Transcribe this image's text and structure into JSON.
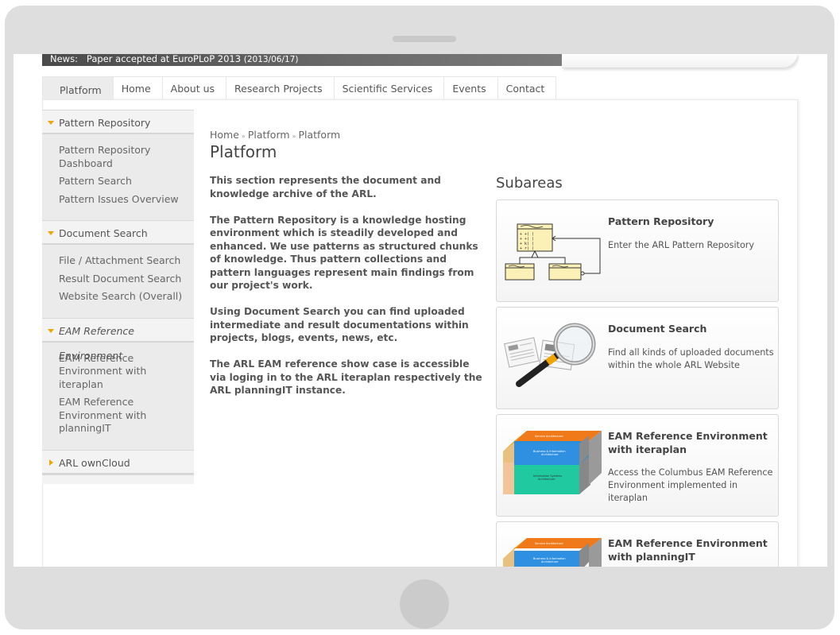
{
  "news": {
    "label": "News:",
    "text": "Paper accepted at EuroPLoP 2013",
    "date": "(2013/06/17)"
  },
  "tabs": [
    {
      "label": "Platform",
      "active": true
    },
    {
      "label": "Home"
    },
    {
      "label": "About us"
    },
    {
      "label": "Research Projects"
    },
    {
      "label": "Scientific Services"
    },
    {
      "label": "Events"
    },
    {
      "label": "Contact"
    }
  ],
  "sidebar": {
    "sections": [
      {
        "title": "Pattern Repository",
        "items": [
          "Pattern Repository Dashboard",
          "Pattern Search",
          "Pattern Issues Overview"
        ]
      },
      {
        "title": "Document Search",
        "items": [
          "File / Attachment Search",
          "Result Document Search",
          "Website Search (Overall)"
        ]
      },
      {
        "title": "EAM Reference Environment",
        "items": [
          "EAM Reference Environment with iteraplan",
          "EAM Reference Environment with planningIT"
        ]
      },
      {
        "title": "ARL ownCloud"
      }
    ]
  },
  "breadcrumb": [
    "Home",
    "Platform",
    "Platform"
  ],
  "breadcrumb_sep": "»",
  "page_title": "Platform",
  "intro": [
    "This section represents the document and knowledge archive of the ARL.",
    "The Pattern Repository is a knowledge hosting environment which is steadily developed and enhanced. We use patterns as structured chunks of knowledge. Thus pattern collections and pattern languages represent main findings from our project's work.",
    "Using Document Search you can find uploaded intermediate and result documentations within projects, blogs, events, news, etc.",
    "The ARL EAM reference show case is accessible via loging in to the ARL iteraplan respectively the ARL planningIT instance."
  ],
  "subareas": {
    "title": "Subareas",
    "cards": [
      {
        "title": "Pattern Repository",
        "desc": "Enter the ARL Pattern Repository",
        "icon": "uml-diagram-icon"
      },
      {
        "title": "Document Search",
        "desc": "Find all kinds of uploaded documents within the whole ARL Website",
        "icon": "magnifier-documents-icon"
      },
      {
        "title": "EAM Reference Environment with iteraplan",
        "desc": "Access the Columbus EAM Reference Environment implemented in iteraplan",
        "icon": "architecture-cube-icon"
      },
      {
        "title": "EAM Reference Environment with planningIT",
        "desc": "",
        "icon": "architecture-cube-icon"
      }
    ]
  },
  "colors": {
    "accent": "#f0a400",
    "sidebar_bg": "#ebebeb"
  }
}
